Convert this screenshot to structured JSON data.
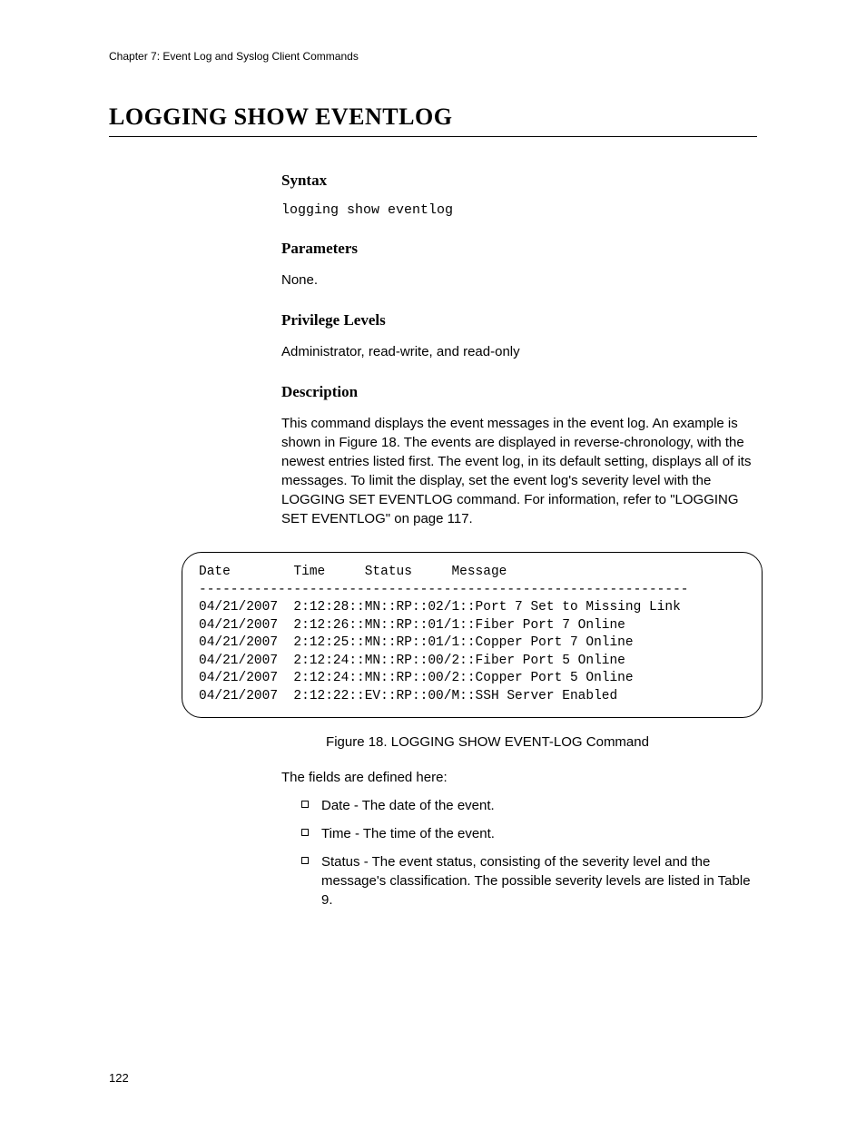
{
  "chapter_header": "Chapter 7: Event Log and Syslog Client Commands",
  "title": "LOGGING SHOW EVENTLOG",
  "syntax": {
    "heading": "Syntax",
    "command": "logging show eventlog"
  },
  "parameters": {
    "heading": "Parameters",
    "text": "None."
  },
  "privilege": {
    "heading": "Privilege Levels",
    "text": "Administrator, read-write, and read-only"
  },
  "description": {
    "heading": "Description",
    "text": "This command displays the event messages in the event log. An example is shown in Figure 18. The events are displayed in reverse-chronology, with the newest entries listed first. The event log, in its default setting, displays all of its messages. To limit the display, set the event log's severity level with the LOGGING SET EVENTLOG command. For information, refer to \"LOGGING SET EVENTLOG\" on page 117."
  },
  "figure": {
    "header": "Date        Time     Status     Message",
    "divider": "--------------------------------------------------------------",
    "rows": [
      "04/21/2007  2:12:28::MN::RP::02/1::Port 7 Set to Missing Link",
      "04/21/2007  2:12:26::MN::RP::01/1::Fiber Port 7 Online",
      "04/21/2007  2:12:25::MN::RP::01/1::Copper Port 7 Online",
      "04/21/2007  2:12:24::MN::RP::00/2::Fiber Port 5 Online",
      "04/21/2007  2:12:24::MN::RP::00/2::Copper Port 5 Online",
      "04/21/2007  2:12:22::EV::RP::00/M::SSH Server Enabled"
    ],
    "caption": "Figure 18. LOGGING SHOW EVENT-LOG Command"
  },
  "fields_intro": "The fields are defined here:",
  "fields": [
    "Date - The date of the event.",
    "Time - The time of the event.",
    "Status - The event status, consisting of the severity level and the message's classification. The possible severity levels are listed in Table 9."
  ],
  "page_number": "122"
}
